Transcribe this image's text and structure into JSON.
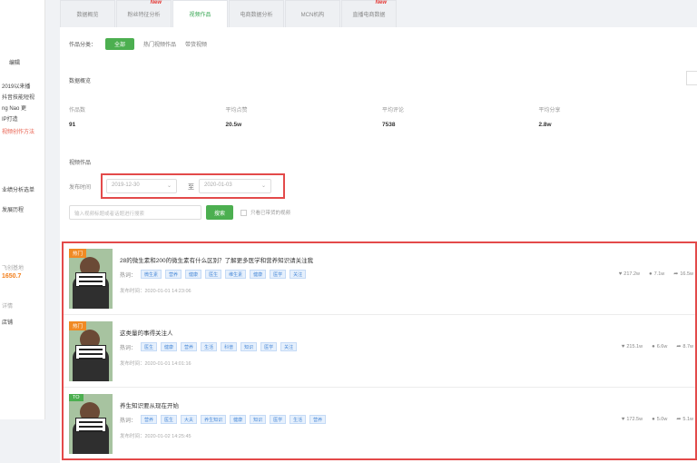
{
  "sidebar": {
    "lines": [
      "",
      "编辑",
      "2019以来播",
      "抖音技能短视",
      "ng Nao 更",
      "IP打造",
      "视频创作方法",
      "",
      "业绩分析选单",
      "发展历程",
      "",
      "",
      "飞创基地",
      "1650.7",
      "详情",
      "店铺",
      "",
      ""
    ]
  },
  "tabs": [
    {
      "label": "数据概览",
      "new": ""
    },
    {
      "label": "粉丝特征分析",
      "new": "New"
    },
    {
      "label": "视频作品",
      "new": ""
    },
    {
      "label": "电商数据分析",
      "new": ""
    },
    {
      "label": "MCN机构",
      "new": ""
    },
    {
      "label": "直播电商数据",
      "new": "New"
    }
  ],
  "filter": {
    "label": "作品分类：",
    "active": "全部",
    "options": [
      "热门视频作品",
      "带货视频"
    ]
  },
  "overview": {
    "title": "数据概览",
    "stats": [
      {
        "label": "作品数",
        "value": "91"
      },
      {
        "label": "平均点赞",
        "value": "20.5w"
      },
      {
        "label": "平均评论",
        "value": "7538"
      },
      {
        "label": "平均分享",
        "value": "2.8w"
      }
    ]
  },
  "video_section": {
    "title": "视频作品",
    "date_label": "发布时间",
    "start_date": "2019-12-30",
    "to_label": "至",
    "end_date": "2020-01-03",
    "search_placeholder": "输入视频标题或者话题进行搜索",
    "search_button": "搜索",
    "checkbox_label": "只看已带货的视频"
  },
  "videos": [
    {
      "badge": "热门",
      "badge_color": "#f08a24",
      "title": "28的微生素和200的微生素有什么区别？了解更多医学和营养知识请关注我",
      "tags_label": "热词：",
      "tags": [
        "微生素",
        "营养",
        "健康",
        "医生",
        "维生素",
        "健康",
        "医学",
        "关注"
      ],
      "publish": "发布时间：2020-01-01 14:23:06",
      "likes": "217.2w",
      "comments": "7.1w",
      "shares": "16.5w"
    },
    {
      "badge": "热门",
      "badge_color": "#f08a24",
      "title": "这类量的事得关注人",
      "tags_label": "热词：",
      "tags": [
        "医生",
        "健康",
        "营养",
        "生活",
        "科普",
        "知识",
        "医学",
        "关注"
      ],
      "publish": "发布时间：2020-01-01 14:01:16",
      "likes": "215.1w",
      "comments": "6.6w",
      "shares": "8.7w"
    },
    {
      "badge": "TO",
      "badge_color": "#4caf50",
      "title": "养生知识要从现在开始",
      "tags_label": "热词：",
      "tags": [
        "营养",
        "医生",
        "大夫",
        "养生知识",
        "健康",
        "知识",
        "医学",
        "生活",
        "营养"
      ],
      "publish": "发布时间：2020-01-02 14:25:45",
      "likes": "172.5w",
      "comments": "5.0w",
      "shares": "5.1w"
    }
  ]
}
